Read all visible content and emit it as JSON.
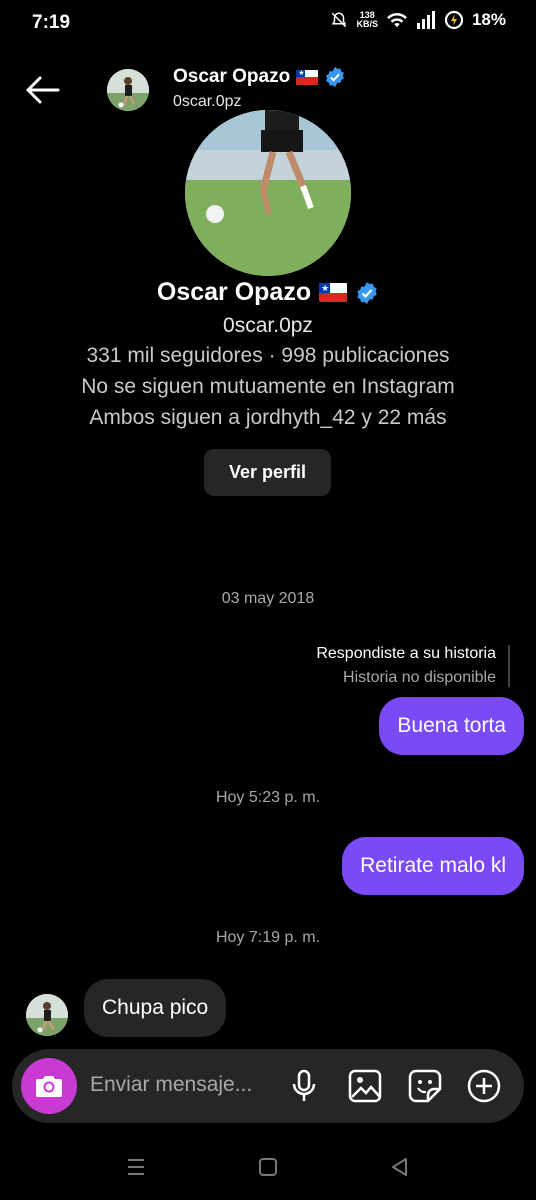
{
  "status_bar": {
    "time": "7:19",
    "net_speed_value": "138",
    "net_speed_unit": "KB/S",
    "battery": "18%"
  },
  "header": {
    "name": "Oscar Opazo",
    "username": "0scar.0pz"
  },
  "profile": {
    "name": "Oscar Opazo",
    "username": "0scar.0pz",
    "stats": "331 mil seguidores · 998 publicaciones",
    "follow_status": "No se siguen mutuamente en Instagram",
    "mutuals": "Ambos siguen a jordhyth_42 y 22 más",
    "view_profile_label": "Ver perfil"
  },
  "messages": [
    {
      "type": "timestamp",
      "text": "03 may 2018"
    },
    {
      "type": "story_reply",
      "label": "Respondiste a su historia",
      "sublabel": "Historia no disponible"
    },
    {
      "type": "outgoing",
      "text": "Buena torta"
    },
    {
      "type": "timestamp",
      "text": "Hoy 5:23 p. m."
    },
    {
      "type": "outgoing",
      "text": "Retirate malo kl"
    },
    {
      "type": "timestamp",
      "text": "Hoy 7:19 p. m."
    },
    {
      "type": "incoming",
      "text": "Chupa pico"
    }
  ],
  "composer": {
    "placeholder": "Enviar mensaje..."
  },
  "colors": {
    "outgoing_bubble": "#7a4af6",
    "incoming_bubble": "#262626",
    "camera_button": "#c93ad5",
    "verified": "#3897f0"
  },
  "icons": [
    "back-arrow-icon",
    "verified-badge-icon",
    "chile-flag-icon",
    "camera-icon",
    "microphone-icon",
    "gallery-icon",
    "sticker-icon",
    "plus-icon",
    "mute-icon",
    "wifi-icon",
    "signal-icon",
    "battery-icon"
  ]
}
